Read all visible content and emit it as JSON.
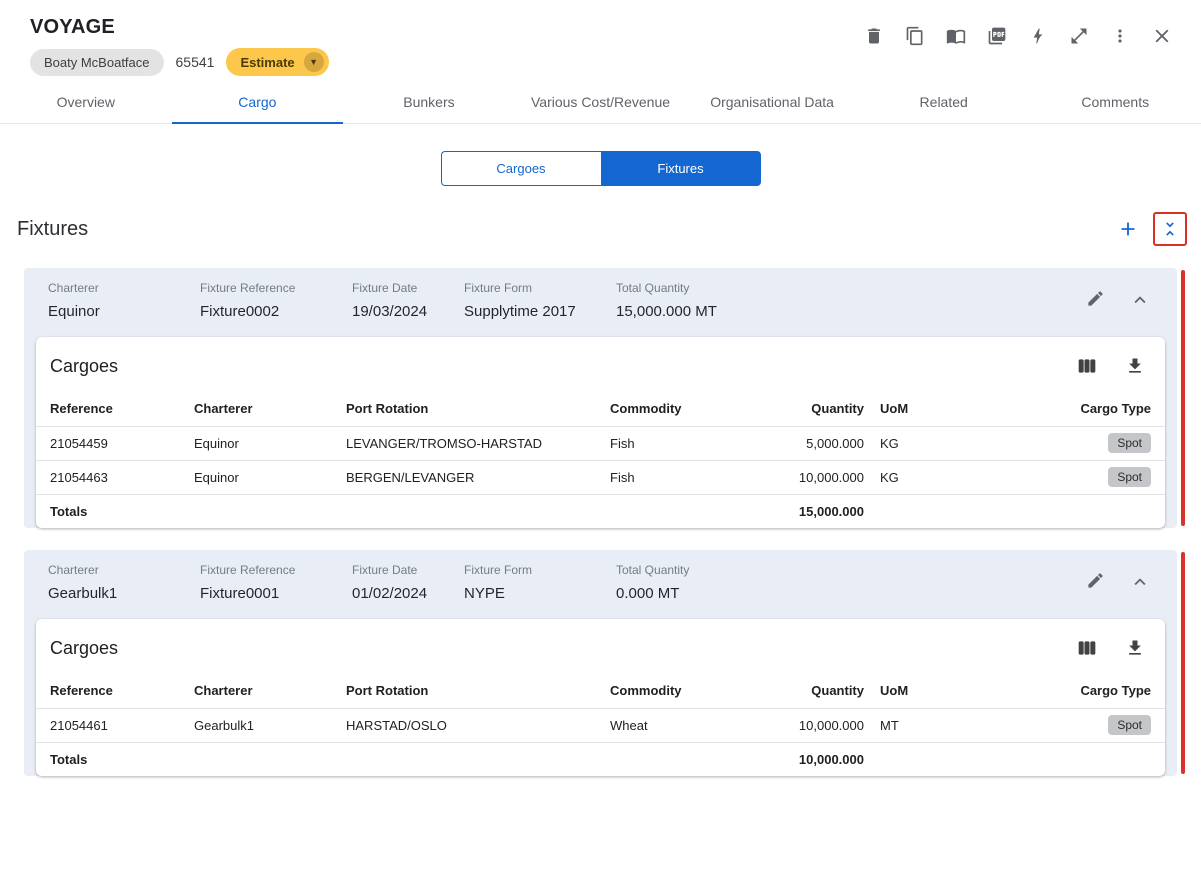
{
  "colors": {
    "accent_blue": "#1467D1",
    "estimate_amber": "#FDC74C",
    "red_indicator": "#DB3327",
    "focus_outline_red": "#D93025",
    "fixture_header_bg": "#E9EEF6",
    "spot_chip_bg": "#C4C6C9"
  },
  "header": {
    "title": "VOYAGE",
    "vessel_chip": "Boaty McBoatface",
    "voyage_number": "65541",
    "estimate_label": "Estimate",
    "action_icons": [
      "delete-icon",
      "copy-icon",
      "book-icon",
      "pdf-icon",
      "bolt-icon",
      "expand-icon",
      "more-vert-icon",
      "close-icon"
    ]
  },
  "tabs": [
    {
      "label": "Overview",
      "active": false
    },
    {
      "label": "Cargo",
      "active": true
    },
    {
      "label": "Bunkers",
      "active": false
    },
    {
      "label": "Various Cost/Revenue",
      "active": false
    },
    {
      "label": "Organisational Data",
      "active": false
    },
    {
      "label": "Related",
      "active": false
    },
    {
      "label": "Comments",
      "active": false
    }
  ],
  "view_toggle": {
    "cargoes_label": "Cargoes",
    "fixtures_label": "Fixtures",
    "active": "Fixtures"
  },
  "section": {
    "title": "Fixtures",
    "action_icons": [
      "add-icon",
      "collapse-all-icon"
    ]
  },
  "fixtures": [
    {
      "fields": [
        {
          "label": "Charterer",
          "value": "Equinor"
        },
        {
          "label": "Fixture Reference",
          "value": "Fixture0002"
        },
        {
          "label": "Fixture Date",
          "value": "19/03/2024"
        },
        {
          "label": "Fixture Form",
          "value": "Supplytime 2017"
        },
        {
          "label": "Total Quantity",
          "value": "15,000.000 MT"
        }
      ],
      "cargoes": {
        "title": "Cargoes",
        "columns": [
          "Reference",
          "Charterer",
          "Port Rotation",
          "Commodity",
          "Quantity",
          "UoM",
          "Cargo Type"
        ],
        "rows": [
          {
            "reference": "21054459",
            "charterer": "Equinor",
            "port_rotation": "LEVANGER/TROMSO-HARSTAD",
            "commodity": "Fish",
            "quantity": "5,000.000",
            "uom": "KG",
            "cargo_type": "Spot"
          },
          {
            "reference": "21054463",
            "charterer": "Equinor",
            "port_rotation": "BERGEN/LEVANGER",
            "commodity": "Fish",
            "quantity": "10,000.000",
            "uom": "KG",
            "cargo_type": "Spot"
          }
        ],
        "totals_label": "Totals",
        "totals_quantity": "15,000.000"
      }
    },
    {
      "fields": [
        {
          "label": "Charterer",
          "value": "Gearbulk1"
        },
        {
          "label": "Fixture Reference",
          "value": "Fixture0001"
        },
        {
          "label": "Fixture Date",
          "value": "01/02/2024"
        },
        {
          "label": "Fixture Form",
          "value": "NYPE"
        },
        {
          "label": "Total Quantity",
          "value": "0.000 MT"
        }
      ],
      "cargoes": {
        "title": "Cargoes",
        "columns": [
          "Reference",
          "Charterer",
          "Port Rotation",
          "Commodity",
          "Quantity",
          "UoM",
          "Cargo Type"
        ],
        "rows": [
          {
            "reference": "21054461",
            "charterer": "Gearbulk1",
            "port_rotation": "HARSTAD/OSLO",
            "commodity": "Wheat",
            "quantity": "10,000.000",
            "uom": "MT",
            "cargo_type": "Spot"
          }
        ],
        "totals_label": "Totals",
        "totals_quantity": "10,000.000"
      }
    }
  ]
}
